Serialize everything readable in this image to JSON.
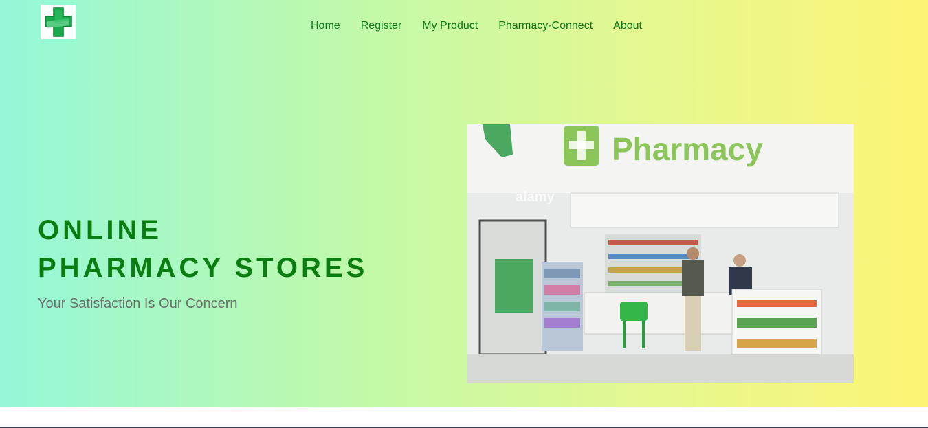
{
  "nav": {
    "logo_icon": "pharmacy-cross-icon",
    "items": [
      "Home",
      "Register",
      "My Product",
      "Pharmacy-Connect",
      "About"
    ]
  },
  "hero": {
    "title_line1": "ONLINE",
    "title_line2": "PHARMACY STORES",
    "subtitle": "Your Satisfaction Is Our Concern",
    "image": {
      "sign_text": "Pharmacy",
      "watermark": "alamy"
    }
  },
  "colors": {
    "gradient_start": "#94f7d8",
    "gradient_end": "#fdf475",
    "nav_link": "#0c7a17",
    "title": "#097d0f",
    "subtitle": "#6b6f6a",
    "pharmacy_green": "#7cc44e"
  }
}
